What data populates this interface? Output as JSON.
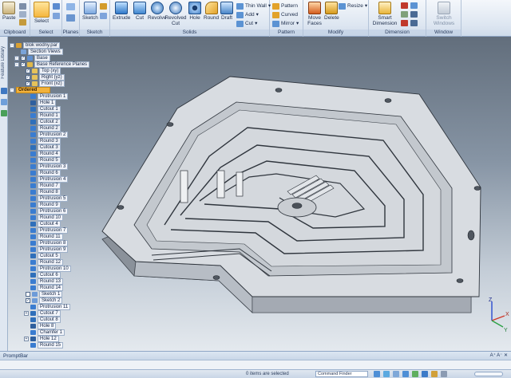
{
  "ribbon": {
    "groups": {
      "clipboard": "Clipboard",
      "select": "Select",
      "planes": "Planes",
      "sketch": "Sketch",
      "solids": "Solids",
      "pattern": "Pattern",
      "modify": "Modify",
      "dimension": "Dimension",
      "window": "Window"
    },
    "paste": "Paste",
    "select": "Select",
    "sketch": "Sketch",
    "extrude": "Extrude",
    "cut": "Cut",
    "revolve": "Revolve",
    "revolved_cut": "Revolved Cut",
    "hole": "Hole",
    "round": "Round",
    "draft": "Draft",
    "thin_wall": "Thin Wall",
    "add": "Add",
    "cut_small": "Cut",
    "pattern": "Pattern",
    "curved": "Curved",
    "mirror": "Mirror",
    "move_faces": "Move Faces",
    "delete": "Delete",
    "resize": "Resize",
    "smart_dimension": "Smart Dimension",
    "switch_windows": "Switch Windows"
  },
  "left_strip": {
    "label": "Feature Library"
  },
  "tree": [
    {
      "label": "blok wodny.par",
      "icon": "part-icon",
      "check": "",
      "expander": "-",
      "indent": 0
    },
    {
      "label": "Section Views",
      "icon": "section-icon",
      "check": "",
      "expander": "",
      "indent": 1
    },
    {
      "label": "Base",
      "icon": "base-icon",
      "check": "✓",
      "expander": "-",
      "indent": 1
    },
    {
      "label": "Base Reference Planes",
      "icon": "planes-icon",
      "check": "✓",
      "expander": "-",
      "indent": 1
    },
    {
      "label": "Top (xy)",
      "icon": "plane-icon",
      "check": "✓",
      "expander": "",
      "indent": 2
    },
    {
      "label": "Right (yz)",
      "icon": "plane-icon",
      "check": "✓",
      "expander": "",
      "indent": 2
    },
    {
      "label": "Front (xz)",
      "icon": "plane-icon",
      "check": "✓",
      "expander": "",
      "indent": 2
    },
    {
      "label": "Ordered",
      "icon": "",
      "check": "",
      "expander": "-",
      "indent": 0,
      "selected": true
    },
    {
      "label": "Protrusion 1",
      "icon": "protrusion-icon",
      "check": "",
      "expander": "",
      "indent": 3
    },
    {
      "label": "Hole 1",
      "icon": "hole-icon",
      "check": "",
      "expander": "",
      "indent": 3
    },
    {
      "label": "Cutout 1",
      "icon": "cutout-icon",
      "check": "",
      "expander": "",
      "indent": 3
    },
    {
      "label": "Round 1",
      "icon": "round-icon",
      "check": "",
      "expander": "",
      "indent": 3
    },
    {
      "label": "Cutout 2",
      "icon": "cutout-icon",
      "check": "",
      "expander": "",
      "indent": 3
    },
    {
      "label": "Round 2",
      "icon": "round-icon",
      "check": "",
      "expander": "",
      "indent": 3
    },
    {
      "label": "Protrusion 2",
      "icon": "protrusion-icon",
      "check": "",
      "expander": "",
      "indent": 3
    },
    {
      "label": "Round 3",
      "icon": "round-icon",
      "check": "",
      "expander": "",
      "indent": 3
    },
    {
      "label": "Cutout 3",
      "icon": "cutout-icon",
      "check": "",
      "expander": "",
      "indent": 3
    },
    {
      "label": "Round 4",
      "icon": "round-icon",
      "check": "",
      "expander": "",
      "indent": 3
    },
    {
      "label": "Round 5",
      "icon": "round-icon",
      "check": "",
      "expander": "",
      "indent": 3
    },
    {
      "label": "Protrusion 3",
      "icon": "protrusion-icon",
      "check": "",
      "expander": "",
      "indent": 3
    },
    {
      "label": "Round 6",
      "icon": "round-icon",
      "check": "",
      "expander": "",
      "indent": 3
    },
    {
      "label": "Protrusion 4",
      "icon": "protrusion-icon",
      "check": "",
      "expander": "",
      "indent": 3
    },
    {
      "label": "Round 7",
      "icon": "round-icon",
      "check": "",
      "expander": "",
      "indent": 3
    },
    {
      "label": "Round 8",
      "icon": "round-icon",
      "check": "",
      "expander": "",
      "indent": 3
    },
    {
      "label": "Protrusion 5",
      "icon": "protrusion-icon",
      "check": "",
      "expander": "",
      "indent": 3
    },
    {
      "label": "Round 9",
      "icon": "round-icon",
      "check": "",
      "expander": "",
      "indent": 3
    },
    {
      "label": "Protrusion 6",
      "icon": "protrusion-icon",
      "check": "",
      "expander": "",
      "indent": 3
    },
    {
      "label": "Round 10",
      "icon": "round-icon",
      "check": "",
      "expander": "",
      "indent": 3
    },
    {
      "label": "Cutout 4",
      "icon": "cutout-icon",
      "check": "",
      "expander": "",
      "indent": 3
    },
    {
      "label": "Protrusion 7",
      "icon": "protrusion-icon",
      "check": "",
      "expander": "",
      "indent": 3
    },
    {
      "label": "Round 11",
      "icon": "round-icon",
      "check": "",
      "expander": "",
      "indent": 3
    },
    {
      "label": "Protrusion 8",
      "icon": "protrusion-icon",
      "check": "",
      "expander": "",
      "indent": 3
    },
    {
      "label": "Protrusion 9",
      "icon": "protrusion-icon",
      "check": "",
      "expander": "",
      "indent": 3
    },
    {
      "label": "Cutout 5",
      "icon": "cutout-icon",
      "check": "",
      "expander": "",
      "indent": 3
    },
    {
      "label": "Round 12",
      "icon": "round-icon",
      "check": "",
      "expander": "",
      "indent": 3
    },
    {
      "label": "Protrusion 10",
      "icon": "protrusion-icon",
      "check": "",
      "expander": "",
      "indent": 3
    },
    {
      "label": "Cutout 6",
      "icon": "cutout-icon",
      "check": "",
      "expander": "",
      "indent": 3
    },
    {
      "label": "Round 13",
      "icon": "round-icon",
      "check": "",
      "expander": "",
      "indent": 3
    },
    {
      "label": "Round 14",
      "icon": "round-icon",
      "check": "",
      "expander": "",
      "indent": 3
    },
    {
      "label": "Sketch 1",
      "icon": "sketch-icon",
      "check": " ",
      "expander": "",
      "indent": 2
    },
    {
      "label": "Sketch 2",
      "icon": "sketch-icon",
      "check": "✓",
      "expander": "",
      "indent": 2
    },
    {
      "label": "Protrusion 11",
      "icon": "protrusion-icon",
      "check": "",
      "expander": "",
      "indent": 3
    },
    {
      "label": "Cutout 7",
      "icon": "cutout-icon",
      "check": "",
      "expander": "+",
      "indent": 3
    },
    {
      "label": "Cutout 8",
      "icon": "cutout-icon",
      "check": "",
      "expander": "",
      "indent": 3
    },
    {
      "label": "Hole 8",
      "icon": "hole-icon",
      "check": "",
      "expander": "",
      "indent": 3
    },
    {
      "label": "Chamfer 1",
      "icon": "chamfer-icon",
      "check": "",
      "expander": "",
      "indent": 3
    },
    {
      "label": "Hole 12",
      "icon": "hole-icon",
      "check": "",
      "expander": "+",
      "indent": 3
    },
    {
      "label": "Round 15",
      "icon": "round-icon",
      "check": "",
      "expander": "",
      "indent": 3
    }
  ],
  "triad": {
    "x": "X",
    "y": "Y",
    "z": "Z"
  },
  "prompt_bar": {
    "title": "PromptBar",
    "controls": "A⁺ A⁻ ✕"
  },
  "status_bar": {
    "selection_message": "0 items are selected",
    "command_finder": "Command Finder"
  },
  "colors": {
    "ribbon_top": "#f4f7fb",
    "ribbon_bottom": "#cfdbea",
    "selected_row": "#f2b23c",
    "viewport_top": "#626e7c",
    "viewport_bottom": "#e4e9ee",
    "model_face": "#d8dce1"
  }
}
